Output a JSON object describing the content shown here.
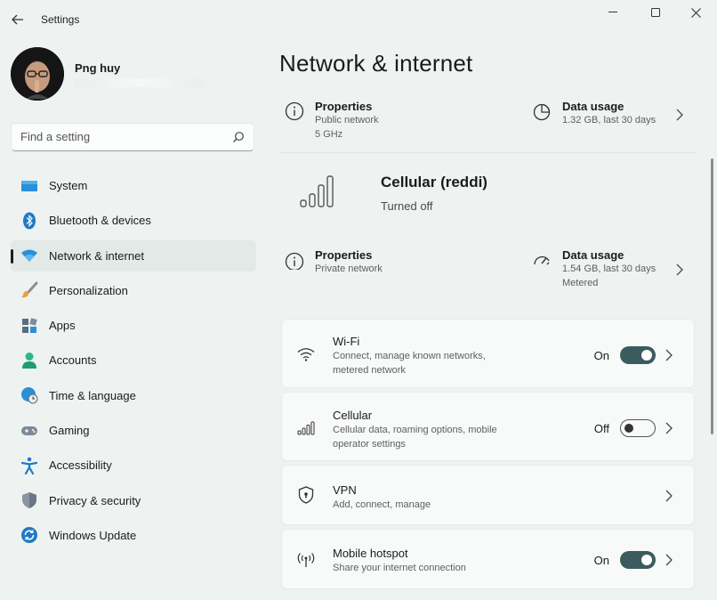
{
  "window": {
    "title": "Settings",
    "controls": {
      "minimize": "—",
      "maximize": "□",
      "close": "✕"
    }
  },
  "profile": {
    "name": "Png huy"
  },
  "search": {
    "placeholder": "Find a setting"
  },
  "nav": {
    "items": [
      {
        "label": "System",
        "icon": "monitor-icon"
      },
      {
        "label": "Bluetooth & devices",
        "icon": "bluetooth-icon"
      },
      {
        "label": "Network & internet",
        "icon": "wifi-icon",
        "active": true
      },
      {
        "label": "Personalization",
        "icon": "brush-icon"
      },
      {
        "label": "Apps",
        "icon": "apps-icon"
      },
      {
        "label": "Accounts",
        "icon": "person-icon"
      },
      {
        "label": "Time & language",
        "icon": "globe-clock-icon"
      },
      {
        "label": "Gaming",
        "icon": "gamepad-icon"
      },
      {
        "label": "Accessibility",
        "icon": "accessibility-icon"
      },
      {
        "label": "Privacy & security",
        "icon": "shield-icon"
      },
      {
        "label": "Windows Update",
        "icon": "update-icon"
      }
    ]
  },
  "main": {
    "title": "Network & internet",
    "wifi_summary": {
      "properties": {
        "title": "Properties",
        "line1": "Public network",
        "line2": "5 GHz"
      },
      "data_usage": {
        "title": "Data usage",
        "line1": "1.32 GB, last 30 days"
      }
    },
    "cellular_summary": {
      "name": "Cellular (reddi)",
      "status": "Turned off",
      "properties": {
        "title": "Properties",
        "line1": "Private network"
      },
      "data_usage": {
        "title": "Data usage",
        "line1": "1.54 GB, last 30 days",
        "line2": "Metered"
      }
    },
    "cards": [
      {
        "title": "Wi-Fi",
        "desc": "Connect, manage known networks, metered network",
        "state": "On",
        "toggle": true,
        "icon": "wifi-icon"
      },
      {
        "title": "Cellular",
        "desc": "Cellular data, roaming options, mobile operator settings",
        "state": "Off",
        "toggle": false,
        "icon": "cellular-signal-icon"
      },
      {
        "title": "VPN",
        "desc": "Add, connect, manage",
        "icon": "vpn-shield-icon"
      },
      {
        "title": "Mobile hotspot",
        "desc": "Share your internet connection",
        "state": "On",
        "toggle": true,
        "icon": "hotspot-icon"
      }
    ]
  },
  "colors": {
    "accent": "#3b5b5e",
    "background": "#eef3f1",
    "card": "#f8fafa"
  }
}
